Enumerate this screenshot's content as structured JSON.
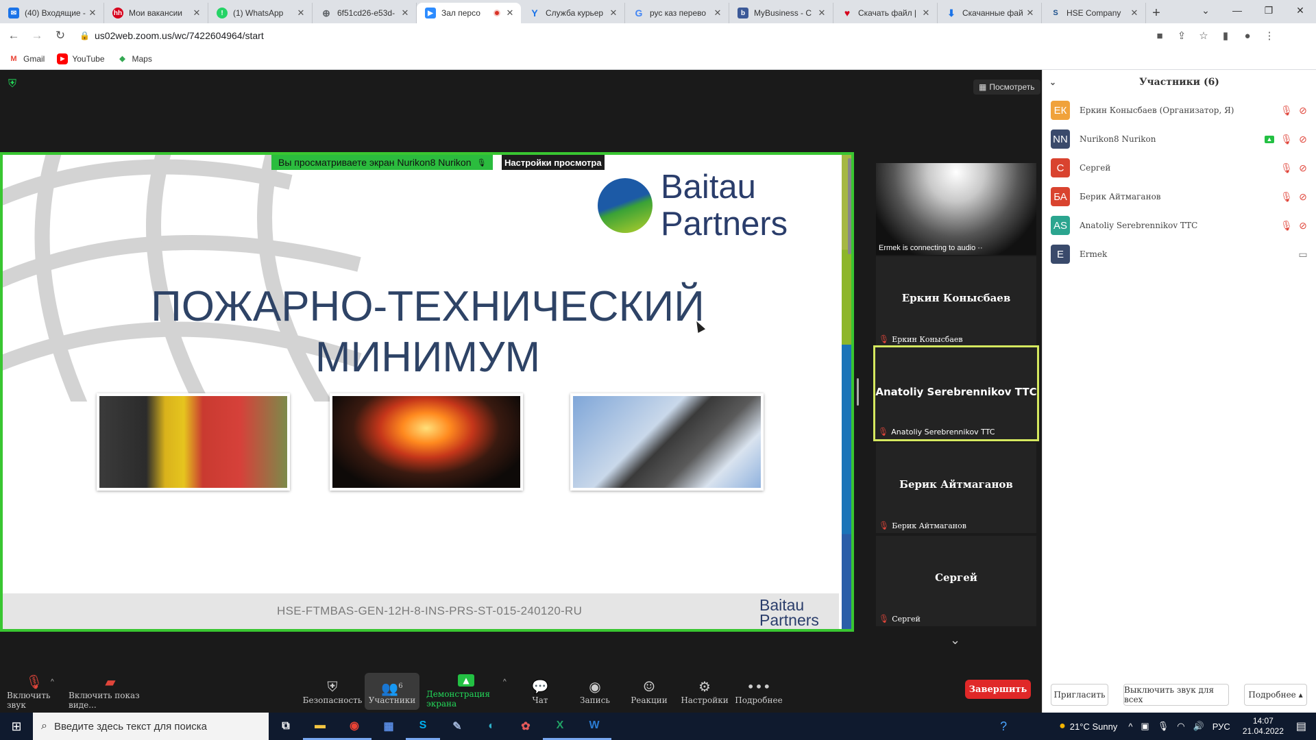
{
  "browser": {
    "tabs": [
      {
        "title": "(40) Входящие -",
        "icon": "mail-icon",
        "color": "#1a73e8"
      },
      {
        "title": "Мои вакансии",
        "icon": "hh-icon",
        "color": "#d6001c"
      },
      {
        "title": "(1) WhatsApp",
        "icon": "whatsapp-icon",
        "color": "#25d366"
      },
      {
        "title": "6f51cd26-e53d-",
        "icon": "globe-icon",
        "color": "#5f6368"
      },
      {
        "title": "Зал персо",
        "icon": "zoom-icon",
        "color": "#2d8cff"
      },
      {
        "title": "Служба курьер",
        "icon": "yandex-icon",
        "color": "#fc3f1d"
      },
      {
        "title": "рус каз перево",
        "icon": "google-icon",
        "color": "#4285f4"
      },
      {
        "title": "MyBusiness - C",
        "icon": "mybusiness-icon",
        "color": "#3b5998"
      },
      {
        "title": "Скачать файл |",
        "icon": "heart-icon",
        "color": "#d6001c"
      },
      {
        "title": "Скачанные фай",
        "icon": "download-icon",
        "color": "#1a73e8"
      },
      {
        "title": "HSE Company",
        "icon": "hse-icon",
        "color": "#1a4f8b"
      }
    ],
    "url": "us02web.zoom.us/wc/7422604964/start",
    "bookmarks": [
      {
        "label": "Gmail",
        "icon": "gmail-icon"
      },
      {
        "label": "YouTube",
        "icon": "youtube-icon"
      },
      {
        "label": "Maps",
        "icon": "maps-icon"
      }
    ]
  },
  "zoom": {
    "view_button": "Посмотреть",
    "share_banner": "Вы просматриваете экран Nurikon8 Nurikon",
    "share_settings": "Настройки просмотра",
    "slide": {
      "logo_line1": "Baitau",
      "logo_line2": "Partners",
      "title_line1": "ПОЖАРНО-ТЕХНИЧЕСКИЙ",
      "title_line2": "МИНИМУМ",
      "code": "HSE-FTMBAS-GEN-12H-8-INS-PRS-ST-015-240120-RU",
      "mini_logo1": "Baitau",
      "mini_logo2": "Partners"
    },
    "videos": [
      {
        "center": "",
        "tag": "Ermek is connecting to audio ··"
      },
      {
        "center": "Еркин Конысбаев",
        "tag": "Еркин Конысбаев"
      },
      {
        "center": "Anatoliy Serebrennikov TTC",
        "tag": "Anatoliy Serebrennikov TTC"
      },
      {
        "center": "Берик Айтмаганов",
        "tag": "Берик Айтмаганов"
      },
      {
        "center": "Сергей",
        "tag": "Сергей"
      }
    ],
    "participants": {
      "header": "Участники (6)",
      "list": [
        {
          "initials": "ЕК",
          "name": "Еркин Конысбаев (Организатор, Я)",
          "color": "#f0a23b"
        },
        {
          "initials": "NN",
          "name": "Nurikon8 Nurikon",
          "color": "#3a4a6b"
        },
        {
          "initials": "С",
          "name": "Сергей",
          "color": "#d9432f"
        },
        {
          "initials": "БА",
          "name": "Берик Айтмаганов",
          "color": "#d9432f"
        },
        {
          "initials": "AS",
          "name": "Anatoliy Serebrennikov TTC",
          "color": "#2ba58f"
        },
        {
          "initials": "E",
          "name": "Ermek",
          "color": "#3a4a6b"
        }
      ],
      "invite": "Пригласить",
      "mute_all": "Выключить звук для всех",
      "more": "Подробнее ▴"
    },
    "toolbar": {
      "audio": "Включить звук",
      "video": "Включить показ виде...",
      "security": "Безопасность",
      "participants": "Участники",
      "participants_count": "6",
      "share": "Демонстрация экрана",
      "chat": "Чат",
      "record": "Запись",
      "reactions": "Реакции",
      "settings": "Настройки",
      "more": "Подробнее",
      "end": "Завершить"
    }
  },
  "taskbar": {
    "search_placeholder": "Введите здесь текст для поиска",
    "weather": "21°C  Sunny",
    "lang": "РУС",
    "time": "14:07",
    "date": "21.04.2022"
  }
}
